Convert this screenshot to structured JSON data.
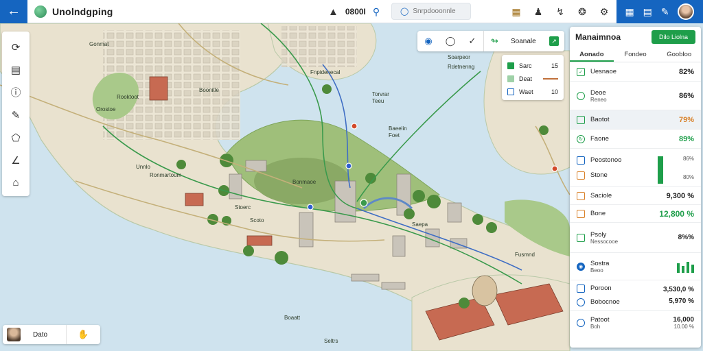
{
  "app": {
    "title": "Unolndgping"
  },
  "toolbar": {
    "coordinate_readout": "0800I",
    "search_placeholder": "Snrpdooonnle"
  },
  "map": {
    "labels": [
      "Gonmat",
      "Rooktoot",
      "Boonitle",
      "Orostoe",
      "Ronmartoum",
      "Unnlo",
      "Stoerc",
      "Scoto",
      "Bonmaoe",
      "Torvrar",
      "Teeu",
      "Baeelin",
      "Foet",
      "Soarpeor",
      "Rdetnenng",
      "Boaatt",
      "Seltrs",
      "Saepa",
      "Fusmnd",
      "Fnpidenecal"
    ]
  },
  "float_tools": {
    "label": "Soanale"
  },
  "legend": {
    "items": [
      {
        "label": "Sarc",
        "value": "15",
        "color": "#1e9e4a"
      },
      {
        "label": "Deat",
        "value": "",
        "color": "#c0703a"
      },
      {
        "label": "Waet",
        "value": "10",
        "color": "#1565c0"
      }
    ]
  },
  "locate_card": {
    "label": "Dato"
  },
  "panel": {
    "title": "Manaimnoa",
    "action_label": "Dilo Liolna",
    "tabs": [
      "Aonado",
      "Fondeo",
      "Goobloo"
    ],
    "rows": [
      {
        "label": "Uesnaoe",
        "value": "82%"
      },
      {
        "label": "Deoe",
        "sub": "Reneo",
        "value": "86%"
      },
      {
        "label": "Baotot",
        "value": "79%"
      },
      {
        "label": "Faone",
        "value": "89%"
      },
      {
        "label": "Peostonoo",
        "sub": "Stone",
        "value_a": "86%",
        "value_b": "80%"
      },
      {
        "label": "Saciole",
        "value": "9,300 %"
      },
      {
        "label": "Bone",
        "value": "12,800 %"
      },
      {
        "label": "Psoly",
        "sub": "Nessocooe",
        "value": "8%%"
      },
      {
        "label": "Sostra",
        "sub": "Beoo"
      },
      {
        "label": "Poroon",
        "value": "3,530,0 %"
      },
      {
        "label": "Bobocnoe",
        "value": "5,970 %"
      },
      {
        "label": "Patoot",
        "sub": "Boh",
        "value_a": "16,000",
        "value_b": "10.00 %"
      }
    ]
  },
  "colors": {
    "brand": "#1565c0",
    "accent": "#1e9e4a",
    "warning": "#d9822b",
    "water": "#cfe3ee",
    "land": "#e9e2cf"
  }
}
